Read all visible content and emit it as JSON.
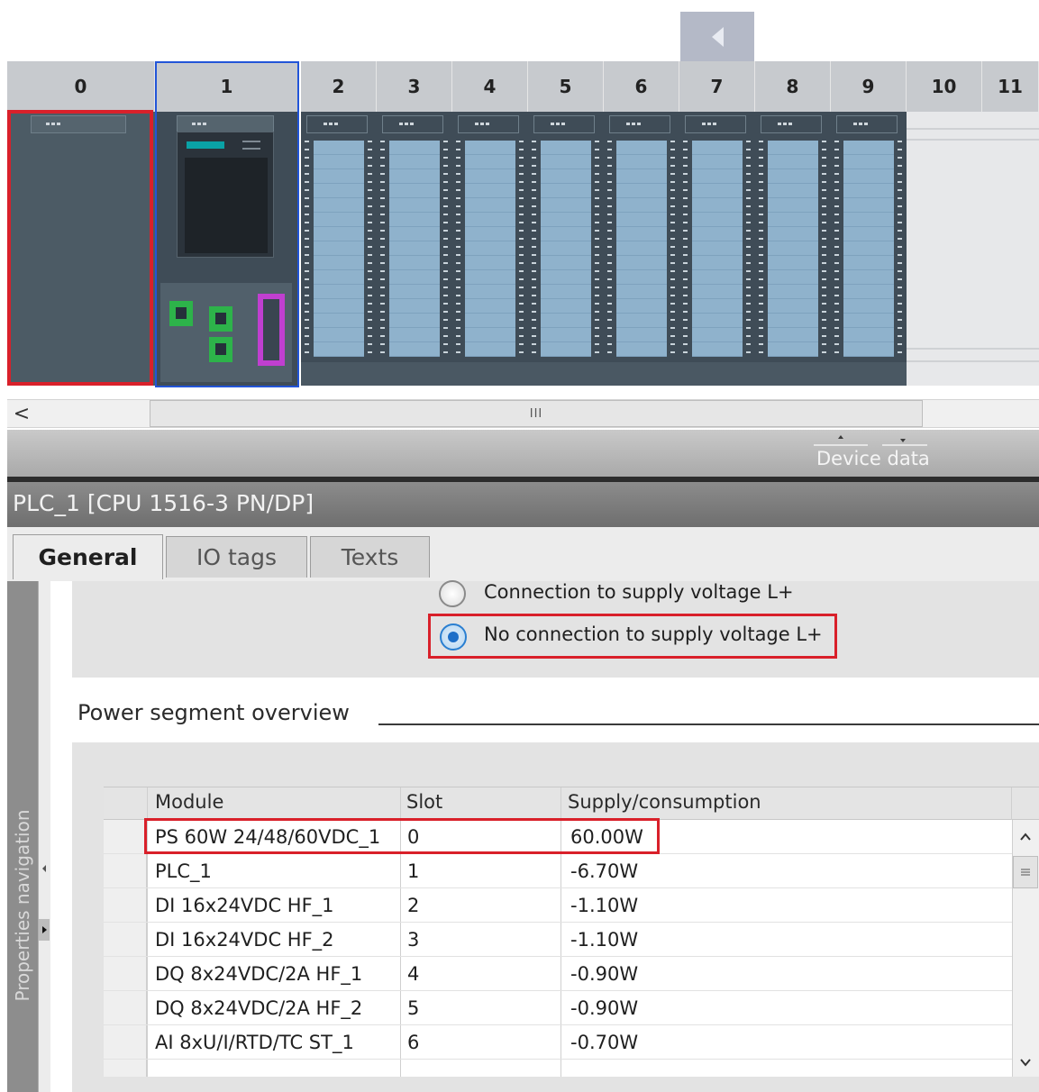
{
  "rack": {
    "slots": [
      "0",
      "1",
      "2",
      "3",
      "4",
      "5",
      "6",
      "7",
      "8",
      "9",
      "10",
      "11"
    ]
  },
  "scrollbar": {
    "thumb_glyph": "III",
    "left_arrow": "<"
  },
  "device_data": {
    "label": "Device data"
  },
  "properties": {
    "title": "PLC_1 [CPU 1516-3 PN/DP]",
    "tabs": [
      {
        "label": "General",
        "active": true
      },
      {
        "label": "IO tags",
        "active": false
      },
      {
        "label": "Texts",
        "active": false
      }
    ],
    "nav_label": "Properties navigation"
  },
  "supply_voltage": {
    "options": [
      {
        "label": "Connection to supply voltage L+",
        "selected": false
      },
      {
        "label": "No connection to supply voltage L+",
        "selected": true
      }
    ]
  },
  "power_segment": {
    "heading": "Power segment overview",
    "columns": [
      "Module",
      "Slot",
      "Supply/consumption"
    ],
    "rows": [
      {
        "module": "PS 60W 24/48/60VDC_1",
        "slot": "0",
        "supply": "60.00W"
      },
      {
        "module": "PLC_1",
        "slot": "1",
        "supply": "-6.70W"
      },
      {
        "module": "DI 16x24VDC HF_1",
        "slot": "2",
        "supply": "-1.10W"
      },
      {
        "module": "DI 16x24VDC HF_2",
        "slot": "3",
        "supply": "-1.10W"
      },
      {
        "module": "DQ 8x24VDC/2A HF_1",
        "slot": "4",
        "supply": "-0.90W"
      },
      {
        "module": "DQ 8x24VDC/2A HF_2",
        "slot": "5",
        "supply": "-0.90W"
      },
      {
        "module": "AI 8xU/I/RTD/TC ST_1",
        "slot": "6",
        "supply": "-0.70W"
      }
    ]
  },
  "colors": {
    "highlight_red": "#d9202a",
    "selection_blue": "#2255d8",
    "module_dark": "#3f4c57",
    "io_panel_blue": "#8fb2cc",
    "port_green": "#2db34a",
    "port_magenta": "#c03fd0"
  },
  "icons": {
    "back": "triangle-left-icon",
    "scroll_up": "chevron-up-icon",
    "scroll_down": "chevron-down-icon"
  }
}
